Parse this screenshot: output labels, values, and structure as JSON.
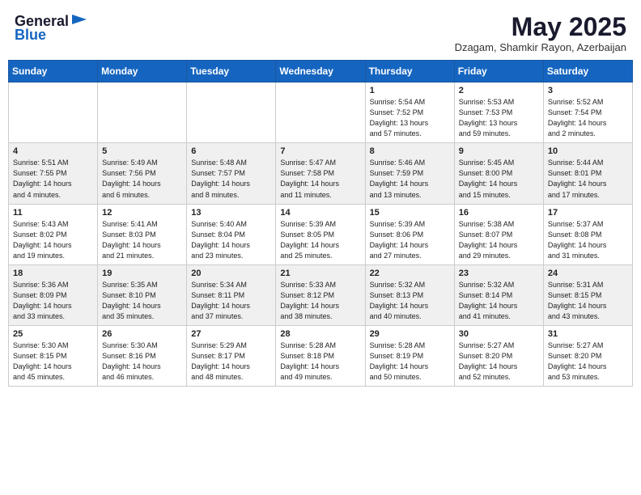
{
  "logo": {
    "general": "General",
    "blue": "Blue"
  },
  "header": {
    "month_year": "May 2025",
    "location": "Dzagam, Shamkir Rayon, Azerbaijan"
  },
  "days_of_week": [
    "Sunday",
    "Monday",
    "Tuesday",
    "Wednesday",
    "Thursday",
    "Friday",
    "Saturday"
  ],
  "weeks": [
    [
      {
        "day": "",
        "info": ""
      },
      {
        "day": "",
        "info": ""
      },
      {
        "day": "",
        "info": ""
      },
      {
        "day": "",
        "info": ""
      },
      {
        "day": "1",
        "info": "Sunrise: 5:54 AM\nSunset: 7:52 PM\nDaylight: 13 hours\nand 57 minutes."
      },
      {
        "day": "2",
        "info": "Sunrise: 5:53 AM\nSunset: 7:53 PM\nDaylight: 13 hours\nand 59 minutes."
      },
      {
        "day": "3",
        "info": "Sunrise: 5:52 AM\nSunset: 7:54 PM\nDaylight: 14 hours\nand 2 minutes."
      }
    ],
    [
      {
        "day": "4",
        "info": "Sunrise: 5:51 AM\nSunset: 7:55 PM\nDaylight: 14 hours\nand 4 minutes."
      },
      {
        "day": "5",
        "info": "Sunrise: 5:49 AM\nSunset: 7:56 PM\nDaylight: 14 hours\nand 6 minutes."
      },
      {
        "day": "6",
        "info": "Sunrise: 5:48 AM\nSunset: 7:57 PM\nDaylight: 14 hours\nand 8 minutes."
      },
      {
        "day": "7",
        "info": "Sunrise: 5:47 AM\nSunset: 7:58 PM\nDaylight: 14 hours\nand 11 minutes."
      },
      {
        "day": "8",
        "info": "Sunrise: 5:46 AM\nSunset: 7:59 PM\nDaylight: 14 hours\nand 13 minutes."
      },
      {
        "day": "9",
        "info": "Sunrise: 5:45 AM\nSunset: 8:00 PM\nDaylight: 14 hours\nand 15 minutes."
      },
      {
        "day": "10",
        "info": "Sunrise: 5:44 AM\nSunset: 8:01 PM\nDaylight: 14 hours\nand 17 minutes."
      }
    ],
    [
      {
        "day": "11",
        "info": "Sunrise: 5:43 AM\nSunset: 8:02 PM\nDaylight: 14 hours\nand 19 minutes."
      },
      {
        "day": "12",
        "info": "Sunrise: 5:41 AM\nSunset: 8:03 PM\nDaylight: 14 hours\nand 21 minutes."
      },
      {
        "day": "13",
        "info": "Sunrise: 5:40 AM\nSunset: 8:04 PM\nDaylight: 14 hours\nand 23 minutes."
      },
      {
        "day": "14",
        "info": "Sunrise: 5:39 AM\nSunset: 8:05 PM\nDaylight: 14 hours\nand 25 minutes."
      },
      {
        "day": "15",
        "info": "Sunrise: 5:39 AM\nSunset: 8:06 PM\nDaylight: 14 hours\nand 27 minutes."
      },
      {
        "day": "16",
        "info": "Sunrise: 5:38 AM\nSunset: 8:07 PM\nDaylight: 14 hours\nand 29 minutes."
      },
      {
        "day": "17",
        "info": "Sunrise: 5:37 AM\nSunset: 8:08 PM\nDaylight: 14 hours\nand 31 minutes."
      }
    ],
    [
      {
        "day": "18",
        "info": "Sunrise: 5:36 AM\nSunset: 8:09 PM\nDaylight: 14 hours\nand 33 minutes."
      },
      {
        "day": "19",
        "info": "Sunrise: 5:35 AM\nSunset: 8:10 PM\nDaylight: 14 hours\nand 35 minutes."
      },
      {
        "day": "20",
        "info": "Sunrise: 5:34 AM\nSunset: 8:11 PM\nDaylight: 14 hours\nand 37 minutes."
      },
      {
        "day": "21",
        "info": "Sunrise: 5:33 AM\nSunset: 8:12 PM\nDaylight: 14 hours\nand 38 minutes."
      },
      {
        "day": "22",
        "info": "Sunrise: 5:32 AM\nSunset: 8:13 PM\nDaylight: 14 hours\nand 40 minutes."
      },
      {
        "day": "23",
        "info": "Sunrise: 5:32 AM\nSunset: 8:14 PM\nDaylight: 14 hours\nand 41 minutes."
      },
      {
        "day": "24",
        "info": "Sunrise: 5:31 AM\nSunset: 8:15 PM\nDaylight: 14 hours\nand 43 minutes."
      }
    ],
    [
      {
        "day": "25",
        "info": "Sunrise: 5:30 AM\nSunset: 8:15 PM\nDaylight: 14 hours\nand 45 minutes."
      },
      {
        "day": "26",
        "info": "Sunrise: 5:30 AM\nSunset: 8:16 PM\nDaylight: 14 hours\nand 46 minutes."
      },
      {
        "day": "27",
        "info": "Sunrise: 5:29 AM\nSunset: 8:17 PM\nDaylight: 14 hours\nand 48 minutes."
      },
      {
        "day": "28",
        "info": "Sunrise: 5:28 AM\nSunset: 8:18 PM\nDaylight: 14 hours\nand 49 minutes."
      },
      {
        "day": "29",
        "info": "Sunrise: 5:28 AM\nSunset: 8:19 PM\nDaylight: 14 hours\nand 50 minutes."
      },
      {
        "day": "30",
        "info": "Sunrise: 5:27 AM\nSunset: 8:20 PM\nDaylight: 14 hours\nand 52 minutes."
      },
      {
        "day": "31",
        "info": "Sunrise: 5:27 AM\nSunset: 8:20 PM\nDaylight: 14 hours\nand 53 minutes."
      }
    ]
  ]
}
